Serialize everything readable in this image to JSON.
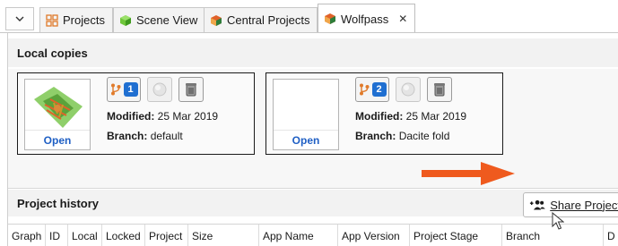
{
  "tabs": [
    {
      "label": "Projects",
      "icon": "grid-icon",
      "color": "#e07a2a"
    },
    {
      "label": "Scene View",
      "icon": "cube-icon",
      "color": "#5cb82b"
    },
    {
      "label": "Central Projects",
      "icon": "hex-logo-icon",
      "color": "#e0622a"
    },
    {
      "label": "Wolfpass",
      "icon": "hex-logo-icon",
      "color": "#e0622a",
      "active": true,
      "close": "✕"
    }
  ],
  "local_copies": {
    "title": "Local copies",
    "cards": [
      {
        "open_label": "Open",
        "branch_count": "1",
        "modified_label": "Modified:",
        "modified_value": "25 Mar 2019",
        "branch_label": "Branch:",
        "branch_value": "default",
        "has_thumbnail": true
      },
      {
        "open_label": "Open",
        "branch_count": "2",
        "modified_label": "Modified:",
        "modified_value": "25 Mar 2019",
        "branch_label": "Branch:",
        "branch_value": "Dacite fold",
        "has_thumbnail": false
      }
    ]
  },
  "history": {
    "title": "Project history",
    "share_label": "Share Project",
    "columns": [
      "Graph",
      "ID",
      "Local",
      "Locked",
      "Project",
      "Size",
      "App Name",
      "App Version",
      "Project Stage",
      "Branch",
      "D"
    ]
  },
  "colors": {
    "accent_blue": "#1f6fd1",
    "link_blue": "#1f5fc4",
    "arrow_orange": "#ef5a1e"
  }
}
